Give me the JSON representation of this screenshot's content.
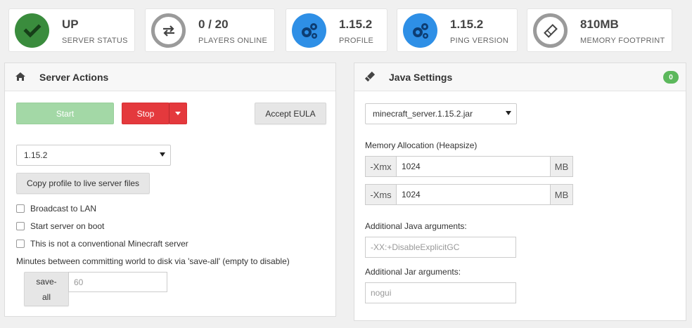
{
  "stats": [
    {
      "value": "UP",
      "label": "SERVER STATUS",
      "icon": "check-icon",
      "color": "#3a8c3d"
    },
    {
      "value": "0 / 20",
      "label": "PLAYERS ONLINE",
      "icon": "exchange-icon",
      "color": "#9a9a9a"
    },
    {
      "value": "1.15.2",
      "label": "PROFILE",
      "icon": "cogs-icon",
      "color": "#2e8fe6"
    },
    {
      "value": "1.15.2",
      "label": "PING VERSION",
      "icon": "cogs-icon",
      "color": "#2e8fe6"
    },
    {
      "value": "810MB",
      "label": "MEMORY FOOTPRINT",
      "icon": "ticket-icon",
      "color": "#9a9a9a"
    }
  ],
  "server_actions": {
    "title": "Server Actions",
    "start_label": "Start",
    "stop_label": "Stop",
    "accept_eula_label": "Accept EULA",
    "profile_select": "1.15.2",
    "copy_profile_label": "Copy profile to live server files",
    "checkboxes": [
      {
        "label": "Broadcast to LAN",
        "checked": false
      },
      {
        "label": "Start server on boot",
        "checked": false
      },
      {
        "label": "This is not a conventional Minecraft server",
        "checked": false
      }
    ],
    "save_interval_text": "Minutes between committing world to disk via 'save-all' (empty to disable)",
    "save_all_label_line1": "save-",
    "save_all_label_line2": "all",
    "save_interval_value": "60"
  },
  "java_settings": {
    "title": "Java Settings",
    "badge": "0",
    "jar_select": "minecraft_server.1.15.2.jar",
    "memory_label": "Memory Allocation (Heapsize)",
    "xmx_prefix": "-Xmx",
    "xmx_value": "1024",
    "xmx_unit": "MB",
    "xms_prefix": "-Xms",
    "xms_value": "1024",
    "xms_unit": "MB",
    "java_args_label": "Additional Java arguments:",
    "java_args_placeholder": "-XX:+DisableExplicitGC",
    "jar_args_label": "Additional Jar arguments:",
    "jar_args_placeholder": "nogui"
  }
}
